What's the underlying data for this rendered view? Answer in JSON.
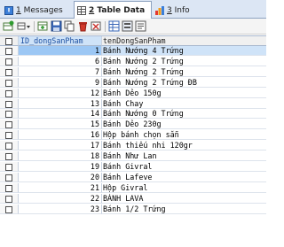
{
  "tabs": [
    {
      "num": "1",
      "label": "Messages"
    },
    {
      "num": "2",
      "label": "Table Data"
    },
    {
      "num": "3",
      "label": "Info"
    }
  ],
  "toolbar": {
    "icons": [
      "new-row-icon",
      "dropdown-icon",
      "add-row-icon",
      "save-icon",
      "copy-icon",
      "delete-icon",
      "cancel-icon",
      "grid-view-icon",
      "form-view-icon",
      "text-view-icon"
    ]
  },
  "colors": {
    "tab_bar": "#dce6f4",
    "header_highlight": "#cfe3f8",
    "selected_cell": "#9cc7f4"
  },
  "table": {
    "columns": [
      "ID_dongSanPham",
      "tenDongSanPham"
    ],
    "rows": [
      [
        "1",
        "Bánh Nướng 4 Trứng"
      ],
      [
        "6",
        "Bánh Nướng 2 Trứng"
      ],
      [
        "7",
        "Bánh Nướng 2 Trứng"
      ],
      [
        "9",
        "Bánh Nướng 2 Trứng ĐB"
      ],
      [
        "12",
        "Bánh Dẻo 150g"
      ],
      [
        "13",
        "Bánh Chay"
      ],
      [
        "14",
        "Bánh Nướng 0 Trứng"
      ],
      [
        "15",
        "Bánh Dẻo 230g"
      ],
      [
        "16",
        "Hộp bánh chọn sẵn"
      ],
      [
        "17",
        "Bánh thiếu nhi 120gr"
      ],
      [
        "18",
        "Bánh Như Lan"
      ],
      [
        "19",
        "Bánh Givral"
      ],
      [
        "20",
        "Bánh Lafeve"
      ],
      [
        "21",
        "Hộp Givral"
      ],
      [
        "22",
        "BÁNH LAVA"
      ],
      [
        "23",
        "Bánh 1/2 Trứng"
      ]
    ]
  }
}
